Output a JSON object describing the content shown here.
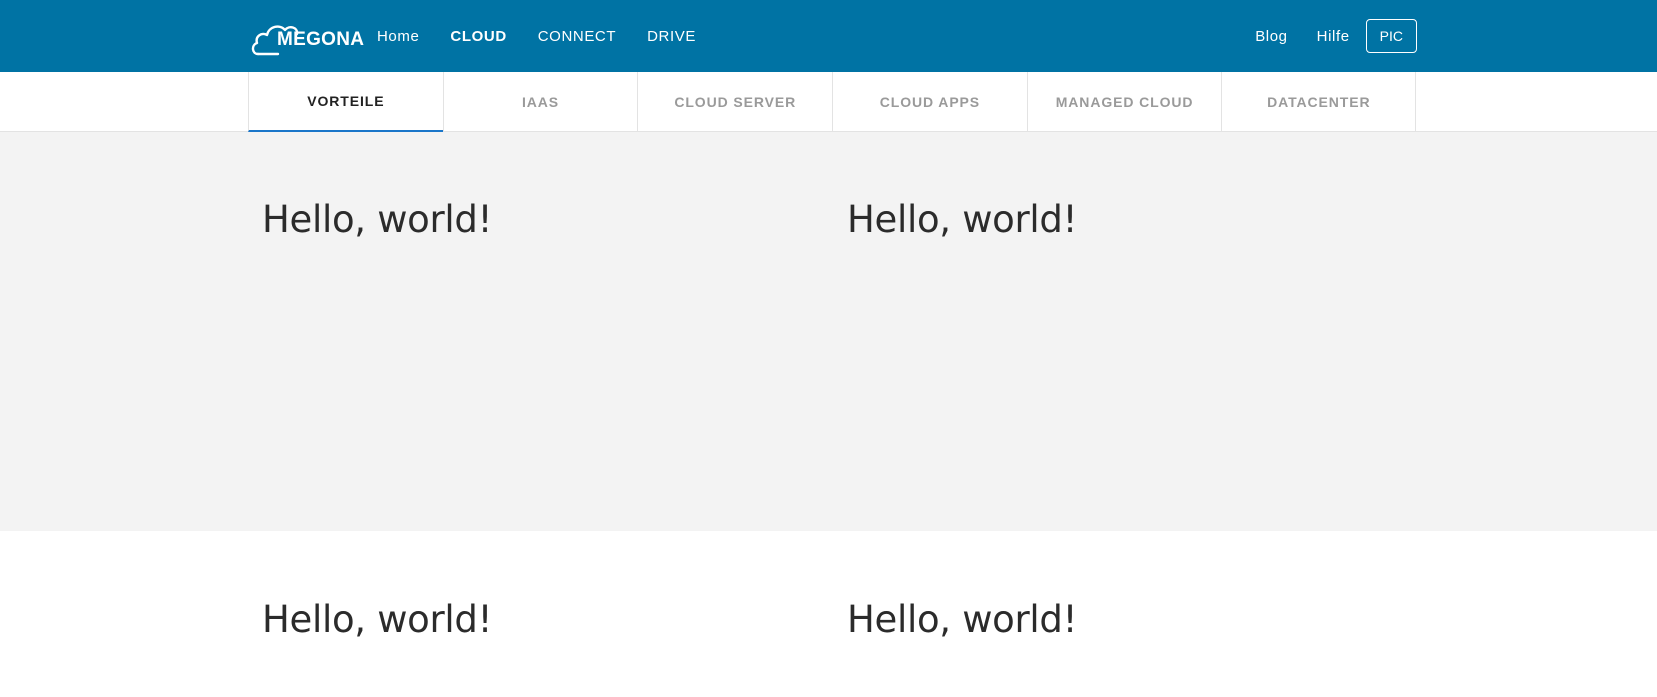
{
  "brand": {
    "logo_text": "MEGONA",
    "bar_color": "#0073a4"
  },
  "main_nav": [
    {
      "label": "Home",
      "active": false
    },
    {
      "label": "CLOUD",
      "active": true
    },
    {
      "label": "CONNECT",
      "active": false
    },
    {
      "label": "DRIVE",
      "active": false
    }
  ],
  "right_nav": {
    "blog": "Blog",
    "help": "Hilfe",
    "pic": "PIC"
  },
  "tabs": [
    {
      "label": "VORTEILE",
      "active": true
    },
    {
      "label": "IAAS",
      "active": false
    },
    {
      "label": "CLOUD SERVER",
      "active": false
    },
    {
      "label": "CLOUD APPS",
      "active": false
    },
    {
      "label": "MANAGED CLOUD",
      "active": false
    },
    {
      "label": "DATACENTER",
      "active": false
    }
  ],
  "sections": {
    "first": {
      "left_heading": "Hello, world!",
      "right_heading": "Hello, world!"
    },
    "second": {
      "left_heading": "Hello, world!",
      "right_heading": "Hello, world!"
    }
  }
}
